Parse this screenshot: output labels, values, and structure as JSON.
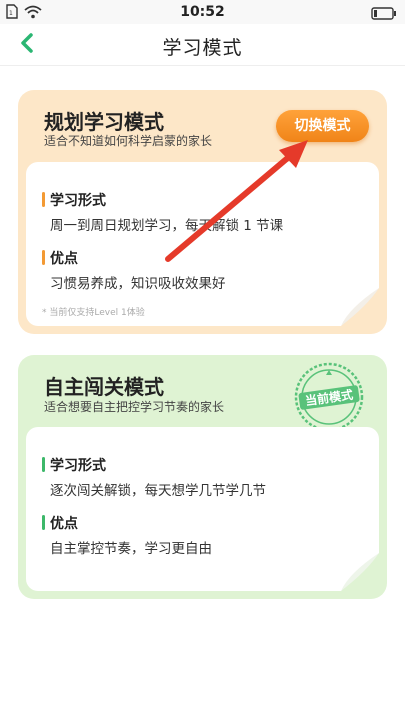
{
  "status_bar": {
    "time": "10:52"
  },
  "nav": {
    "title": "学习模式"
  },
  "colors": {
    "plan_bg": "#fde7c8",
    "self_bg": "#dff3d3",
    "accent_orange": "#f08418",
    "accent_green": "#3db86a",
    "arrow_red": "#e53a2a"
  },
  "plan_mode": {
    "title": "规划学习模式",
    "subtitle": "适合不知道如何科学启蒙的家长",
    "switch_label": "切换模式",
    "form_label": "学习形式",
    "form_text": "周一到周日规划学习，每天解锁 1 节课",
    "merit_label": "优点",
    "merit_text": "习惯易养成，知识吸收效果好",
    "note": "* 当前仅支持Level 1体验"
  },
  "self_mode": {
    "title": "自主闯关模式",
    "subtitle": "适合想要自主把控学习节奏的家长",
    "stamp_label": "当前模式",
    "form_label": "学习形式",
    "form_text": "逐次闯关解锁，每天想学几节学几节",
    "merit_label": "优点",
    "merit_text": "自主掌控节奏，学习更自由"
  }
}
